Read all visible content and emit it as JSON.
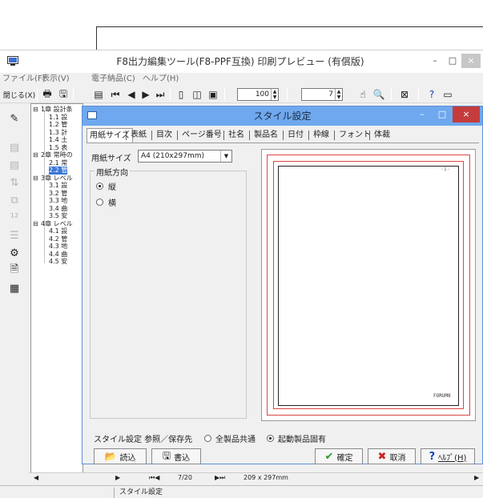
{
  "window": {
    "title": "F8出力編集ツール(F8-PPF互換) 印刷プレビュー (有償版)",
    "minimize": "–",
    "maximize": "□",
    "close": "×"
  },
  "menu": [
    "ファイル(F)",
    "表示(V)",
    "電子納品(C)",
    "ヘルプ(H)"
  ],
  "toolbar": {
    "close_label": "閉じる(X)",
    "zoom_value": "100",
    "page_value": "7"
  },
  "tree": [
    {
      "label": "1章 設計条",
      "level": 0,
      "toggle": "⊟"
    },
    {
      "label": "1.1 設",
      "level": 1
    },
    {
      "label": "1.2 管",
      "level": 1
    },
    {
      "label": "1.3 計",
      "level": 1
    },
    {
      "label": "1.4 土",
      "level": 1
    },
    {
      "label": "1.5 表",
      "level": 1
    },
    {
      "label": "2章 常時の",
      "level": 0,
      "toggle": "⊟"
    },
    {
      "label": "2.1 常",
      "level": 1
    },
    {
      "label": "2.2 管",
      "level": 1,
      "selected": true
    },
    {
      "label": "3章 レベル",
      "level": 0,
      "toggle": "⊟"
    },
    {
      "label": "3.1 設",
      "level": 1
    },
    {
      "label": "3.2 管",
      "level": 1
    },
    {
      "label": "3.3 地",
      "level": 1
    },
    {
      "label": "3.4 曲",
      "level": 1
    },
    {
      "label": "3.5 安",
      "level": 1
    },
    {
      "label": "4章 レベル",
      "level": 0,
      "toggle": "⊟"
    },
    {
      "label": "4.1 設",
      "level": 1
    },
    {
      "label": "4.2 管",
      "level": 1
    },
    {
      "label": "4.3 地",
      "level": 1
    },
    {
      "label": "4.4 曲",
      "level": 1
    },
    {
      "label": "4.5 安",
      "level": 1
    }
  ],
  "bottom": {
    "page_counter": "7/20",
    "paper_size": "209 x 297mm",
    "status": "スタイル設定"
  },
  "dialog": {
    "title": "スタイル設定",
    "tabs": [
      "用紙サイズ",
      "表紙",
      "目次",
      "ページ番号",
      "社名",
      "製品名",
      "日付",
      "枠線",
      "フォント",
      "体裁"
    ],
    "active_tab": 0,
    "paper_size_label": "用紙サイズ",
    "paper_size_value": "A4 (210x297mm)",
    "orientation_label": "用紙方向",
    "orientation_options": [
      {
        "label": "縦",
        "selected": true
      },
      {
        "label": "横",
        "selected": false
      }
    ],
    "preview_page_number": "- 1 -",
    "preview_footer": "FORUM8",
    "style_ref_label": "スタイル設定 参照／保存先",
    "style_ref_options": [
      {
        "label": "全製品共通",
        "selected": false
      },
      {
        "label": "起動製品固有",
        "selected": true
      }
    ],
    "buttons": {
      "load": "読込",
      "save": "書込",
      "ok": "確定",
      "cancel": "取消",
      "help": "ﾍﾙﾌﾟ(H)"
    }
  },
  "colors": {
    "dialog_title": "#6fa8ee",
    "dialog_close": "#c43c3c",
    "tree_selected": "#3b78d8",
    "preview_red": "#dd4444",
    "ok_check": "#2f9a2f",
    "cancel_x": "#cc2222",
    "help_q": "#1a44b8"
  }
}
